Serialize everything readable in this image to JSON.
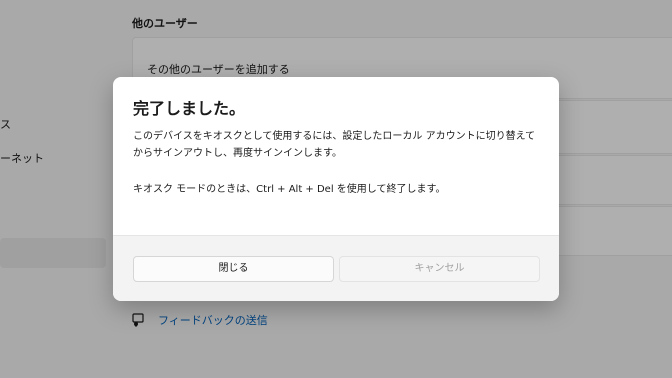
{
  "sidebar": {
    "items": [
      {
        "label": "ス"
      },
      {
        "label": "ーネット"
      }
    ]
  },
  "main": {
    "section_title": "他のユーザー",
    "add_user_label": "その他のユーザーを追加する",
    "feedback_link": "フィードバックの送信"
  },
  "dialog": {
    "title": "完了しました。",
    "body1": "このデバイスをキオスクとして使用するには、設定したローカル アカウントに切り替えてからサインアウトし、再度サインインします。",
    "body2": "キオスク モードのときは、Ctrl + Alt + Del を使用して終了します。",
    "close_label": "閉じる",
    "cancel_label": "キャンセル"
  },
  "icons": {
    "feedback": "feedback-icon"
  },
  "colors": {
    "accent": "#005fb8",
    "overlay": "rgba(0,0,0,0.30)"
  }
}
